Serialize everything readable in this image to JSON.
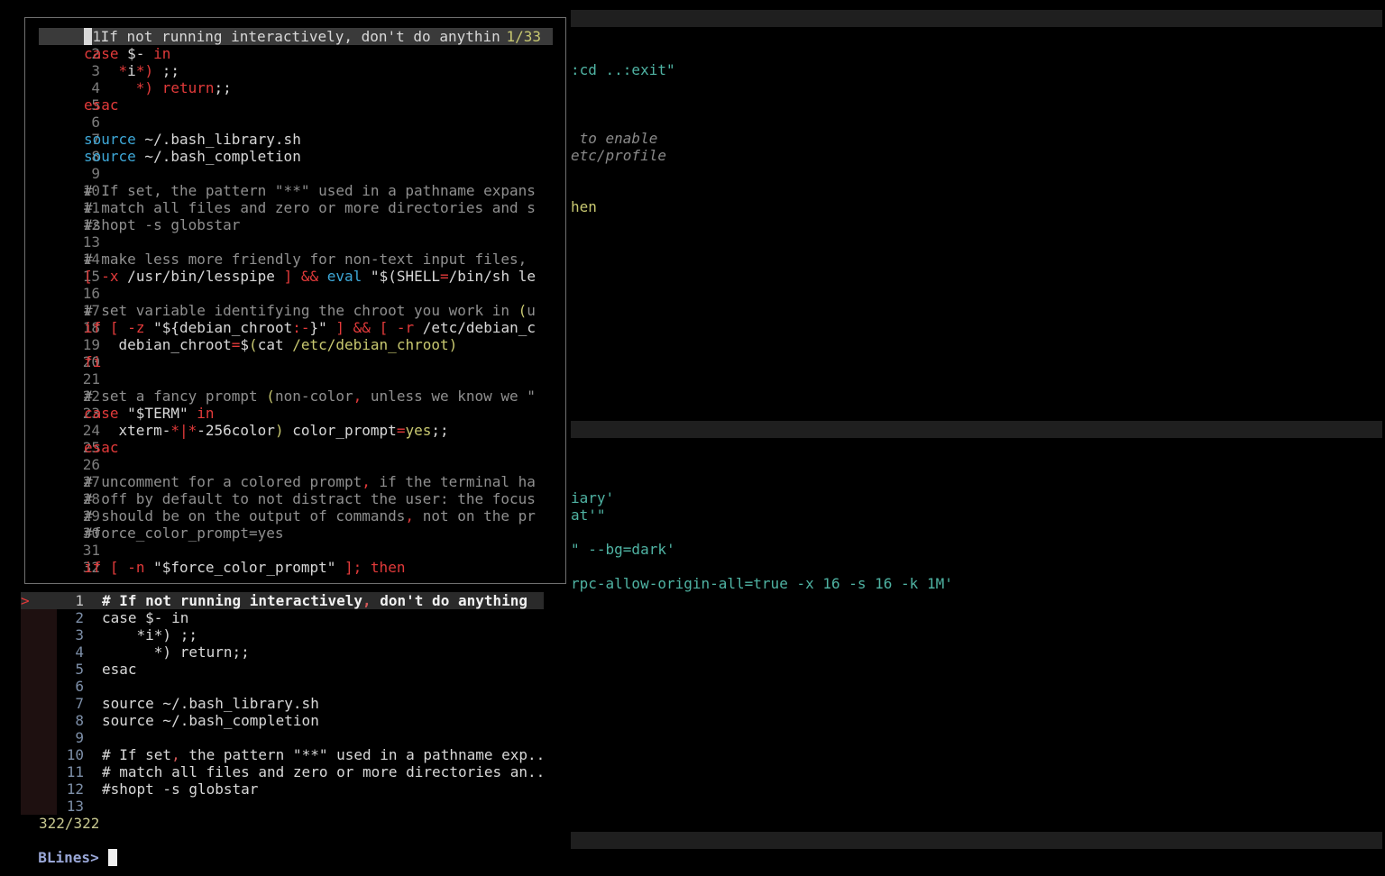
{
  "background_window": {
    "lines": [
      {
        "text": ":cd ..:exit\"",
        "style": "teal"
      },
      {
        "text": " to enable",
        "style": "cmt"
      },
      {
        "text": "etc/profile",
        "style": "cmt"
      },
      {
        "text": "hen",
        "style": "yel"
      },
      {
        "text": "iary'",
        "style": "teal"
      },
      {
        "text": "at'\"",
        "style": "teal"
      },
      {
        "text": "\" --bg=dark'",
        "style": "teal"
      },
      {
        "text": "rpc-allow-origin-all=true -x 16 -s 16 -k 1M'",
        "style": "teal"
      }
    ]
  },
  "preview": {
    "position_indicator": "1/33",
    "lines": [
      {
        "num": "1",
        "html": "# If not running interactively, don't do anythin"
      },
      {
        "num": "2",
        "html": "<span class='kw'>case</span> $- <span class='kw'>in</span>"
      },
      {
        "num": "3",
        "html": "    <span class='kw'>*</span>i<span class='kw'>*)</span> ;;"
      },
      {
        "num": "4",
        "html": "      <span class='kw'>*) return</span>;;"
      },
      {
        "num": "5",
        "html": "<span class='kw'>esac</span>"
      },
      {
        "num": "6",
        "html": ""
      },
      {
        "num": "7",
        "html": "<span class='bi'>source</span> ~/.bash_library.sh"
      },
      {
        "num": "8",
        "html": "<span class='bi'>source</span> ~/.bash_completion"
      },
      {
        "num": "9",
        "html": ""
      },
      {
        "num": "10",
        "html": "<span class='c'># If set, the pattern \"**\" used in a pathname expans</span>"
      },
      {
        "num": "11",
        "html": "<span class='c'># match all files and zero or more directories and s</span>"
      },
      {
        "num": "12",
        "html": "<span class='c'>#shopt -s globstar</span>"
      },
      {
        "num": "13",
        "html": ""
      },
      {
        "num": "14",
        "html": "<span class='c'># make less more friendly for non-text input files,</span>"
      },
      {
        "num": "15",
        "html": "<span class='kw'>[</span> <span class='kw'>-x</span> /usr/bin/lesspipe <span class='kw'>]</span> <span class='kw'>&amp;&amp;</span> <span class='bi'>eval</span> \"$(SHELL<span class='kw'>=</span>/bin/sh le"
      },
      {
        "num": "16",
        "html": ""
      },
      {
        "num": "17",
        "html": "<span class='c'># set variable identifying the chroot you work in </span><span class='yl'>(</span><span class='c'>u</span>"
      },
      {
        "num": "18",
        "html": "<span class='kw'>if</span> <span class='kw'>[</span> <span class='kw'>-z</span> \"${debian_chroot<span class='kw'>:-</span>}\" <span class='kw'>]</span> <span class='kw'>&amp;&amp;</span> <span class='kw'>[</span> <span class='kw'>-r</span> /etc/debian_c"
      },
      {
        "num": "19",
        "html": "    debian_chroot<span class='kw'>=</span>$<span class='yl'>(</span>cat <span class='yl'>/etc/debian_chroot)</span>"
      },
      {
        "num": "20",
        "html": "<span class='kw'>fi</span>"
      },
      {
        "num": "21",
        "html": ""
      },
      {
        "num": "22",
        "html": "<span class='c'># set a fancy prompt </span><span class='yl'>(</span><span class='c'>non-color</span><span class='kw'>,</span><span class='c'> unless we know we \"</span>"
      },
      {
        "num": "23",
        "html": "<span class='kw'>case</span> \"$TERM\" <span class='kw'>in</span>"
      },
      {
        "num": "24",
        "html": "    xterm-<span class='kw'>*|*</span>-256color<span class='yl'>)</span> color_prompt<span class='kw'>=</span><span class='yl'>yes</span>;;"
      },
      {
        "num": "25",
        "html": "<span class='kw'>esac</span>"
      },
      {
        "num": "26",
        "html": ""
      },
      {
        "num": "27",
        "html": "<span class='c'># uncomment for a colored prompt</span><span class='kw'>,</span><span class='c'> if the terminal ha</span>"
      },
      {
        "num": "28",
        "html": "<span class='c'># off by default to not distract the user: the focus</span>"
      },
      {
        "num": "29",
        "html": "<span class='c'># should be on the output of commands</span><span class='kw'>,</span><span class='c'> not on the pr</span>"
      },
      {
        "num": "30",
        "html": "<span class='c'>#force_color_prompt=yes</span>"
      },
      {
        "num": "31",
        "html": ""
      },
      {
        "num": "32",
        "html": "<span class='kw'>if</span> <span class='kw'>[</span> <span class='kw'>-n</span> \"$force_color_prompt\" <span class='kw'>]</span><span class='kw'>; then</span>"
      }
    ]
  },
  "results": {
    "marker": ">",
    "items": [
      {
        "num": "1",
        "html": "# If not running interactively<span class='pk'>,</span> don't do anything"
      },
      {
        "num": "2",
        "html": "case $- in"
      },
      {
        "num": "3",
        "html": "    *i*) ;;"
      },
      {
        "num": "4",
        "html": "      *) return;;"
      },
      {
        "num": "5",
        "html": "esac"
      },
      {
        "num": "6",
        "html": ""
      },
      {
        "num": "7",
        "html": "source ~/.bash_library.sh"
      },
      {
        "num": "8",
        "html": "source ~/.bash_completion"
      },
      {
        "num": "9",
        "html": ""
      },
      {
        "num": "10",
        "html": "# If set<span class='pk'>,</span> the pattern \"**\" used in a pathname exp.."
      },
      {
        "num": "11",
        "html": "# match all files and zero or more directories an.."
      },
      {
        "num": "12",
        "html": "#shopt -s globstar"
      },
      {
        "num": "13",
        "html": ""
      }
    ],
    "count": "322/322"
  },
  "prompt": {
    "label": "BLines>",
    "query": ""
  }
}
